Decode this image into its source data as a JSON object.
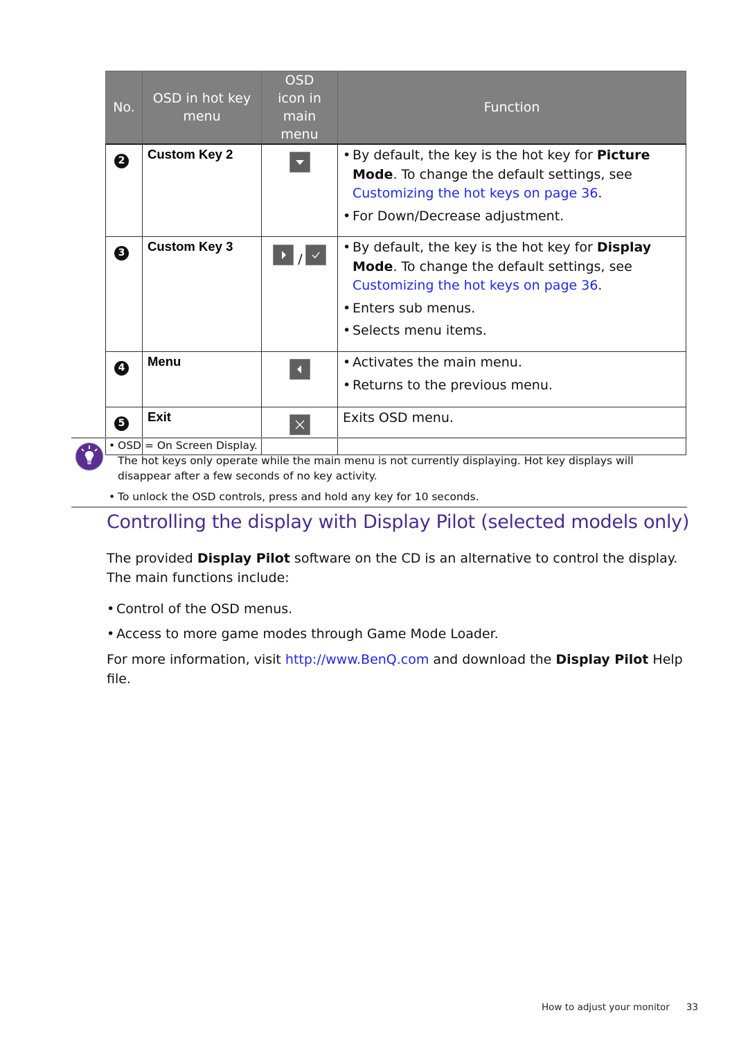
{
  "table": {
    "headers": {
      "no": "No.",
      "hot_key": "OSD in hot key menu",
      "icon": "OSD icon in main menu",
      "function": "Function"
    },
    "rows": [
      {
        "number": "2",
        "hot_key_label": "Custom Key 2",
        "icons": [
          "down-arrow"
        ],
        "functions": [
          {
            "prefix": "By default, the key is the hot key for ",
            "bold": "Picture Mode",
            "middle": ". To change the default settings, see ",
            "link": "Customizing the hot keys on page 36",
            "suffix": "."
          },
          {
            "text": "For Down/Decrease adjustment."
          }
        ]
      },
      {
        "number": "3",
        "hot_key_label": "Custom Key 3",
        "icons": [
          "right-arrow",
          "check"
        ],
        "icon_separator": "/",
        "functions": [
          {
            "prefix": "By default, the key is the hot key for ",
            "bold": "Display Mode",
            "middle": ". To change the default settings, see ",
            "link": "Customizing the hot keys on page 36",
            "suffix": "."
          },
          {
            "text": "Enters sub menus."
          },
          {
            "text": "Selects menu items."
          }
        ]
      },
      {
        "number": "4",
        "hot_key_label": "Menu",
        "icons": [
          "left-arrow"
        ],
        "functions": [
          {
            "text": "Activates the main menu."
          },
          {
            "text": "Returns to the previous menu."
          }
        ]
      },
      {
        "number": "5",
        "hot_key_label": "Exit",
        "icons": [
          "close"
        ],
        "function_plain": "Exits OSD menu."
      }
    ]
  },
  "note": {
    "icon": "lightbulb-icon",
    "items": [
      {
        "bullet": "OSD = On Screen Display.",
        "continuation": "The hot keys only operate while the main menu is not currently displaying. Hot key displays will disappear after a few seconds of no key activity."
      },
      {
        "bullet": "To unlock the OSD controls, press and hold any key for 10 seconds."
      }
    ]
  },
  "section": {
    "title": "Controlling the display with Display Pilot (selected models only)",
    "intro_prefix": "The provided ",
    "intro_bold": "Display Pilot",
    "intro_suffix": " software on the CD is an alternative to control the display. The main functions include:",
    "bullets": [
      "Control of the OSD menus.",
      "Access to more game modes through Game Mode Loader."
    ],
    "more_prefix": "For more information, visit ",
    "more_link": "http://www.BenQ.com",
    "more_middle": " and download the ",
    "more_bold": "Display Pilot",
    "more_suffix": " Help file."
  },
  "footer": {
    "chapter": "How to adjust your monitor",
    "page": "33"
  },
  "colors": {
    "header_bg": "#808080",
    "link": "#1f28e6",
    "section_title": "#4b2a8c",
    "icon_bg": "#5f5f5f",
    "note_icon": "#5b2e91"
  }
}
